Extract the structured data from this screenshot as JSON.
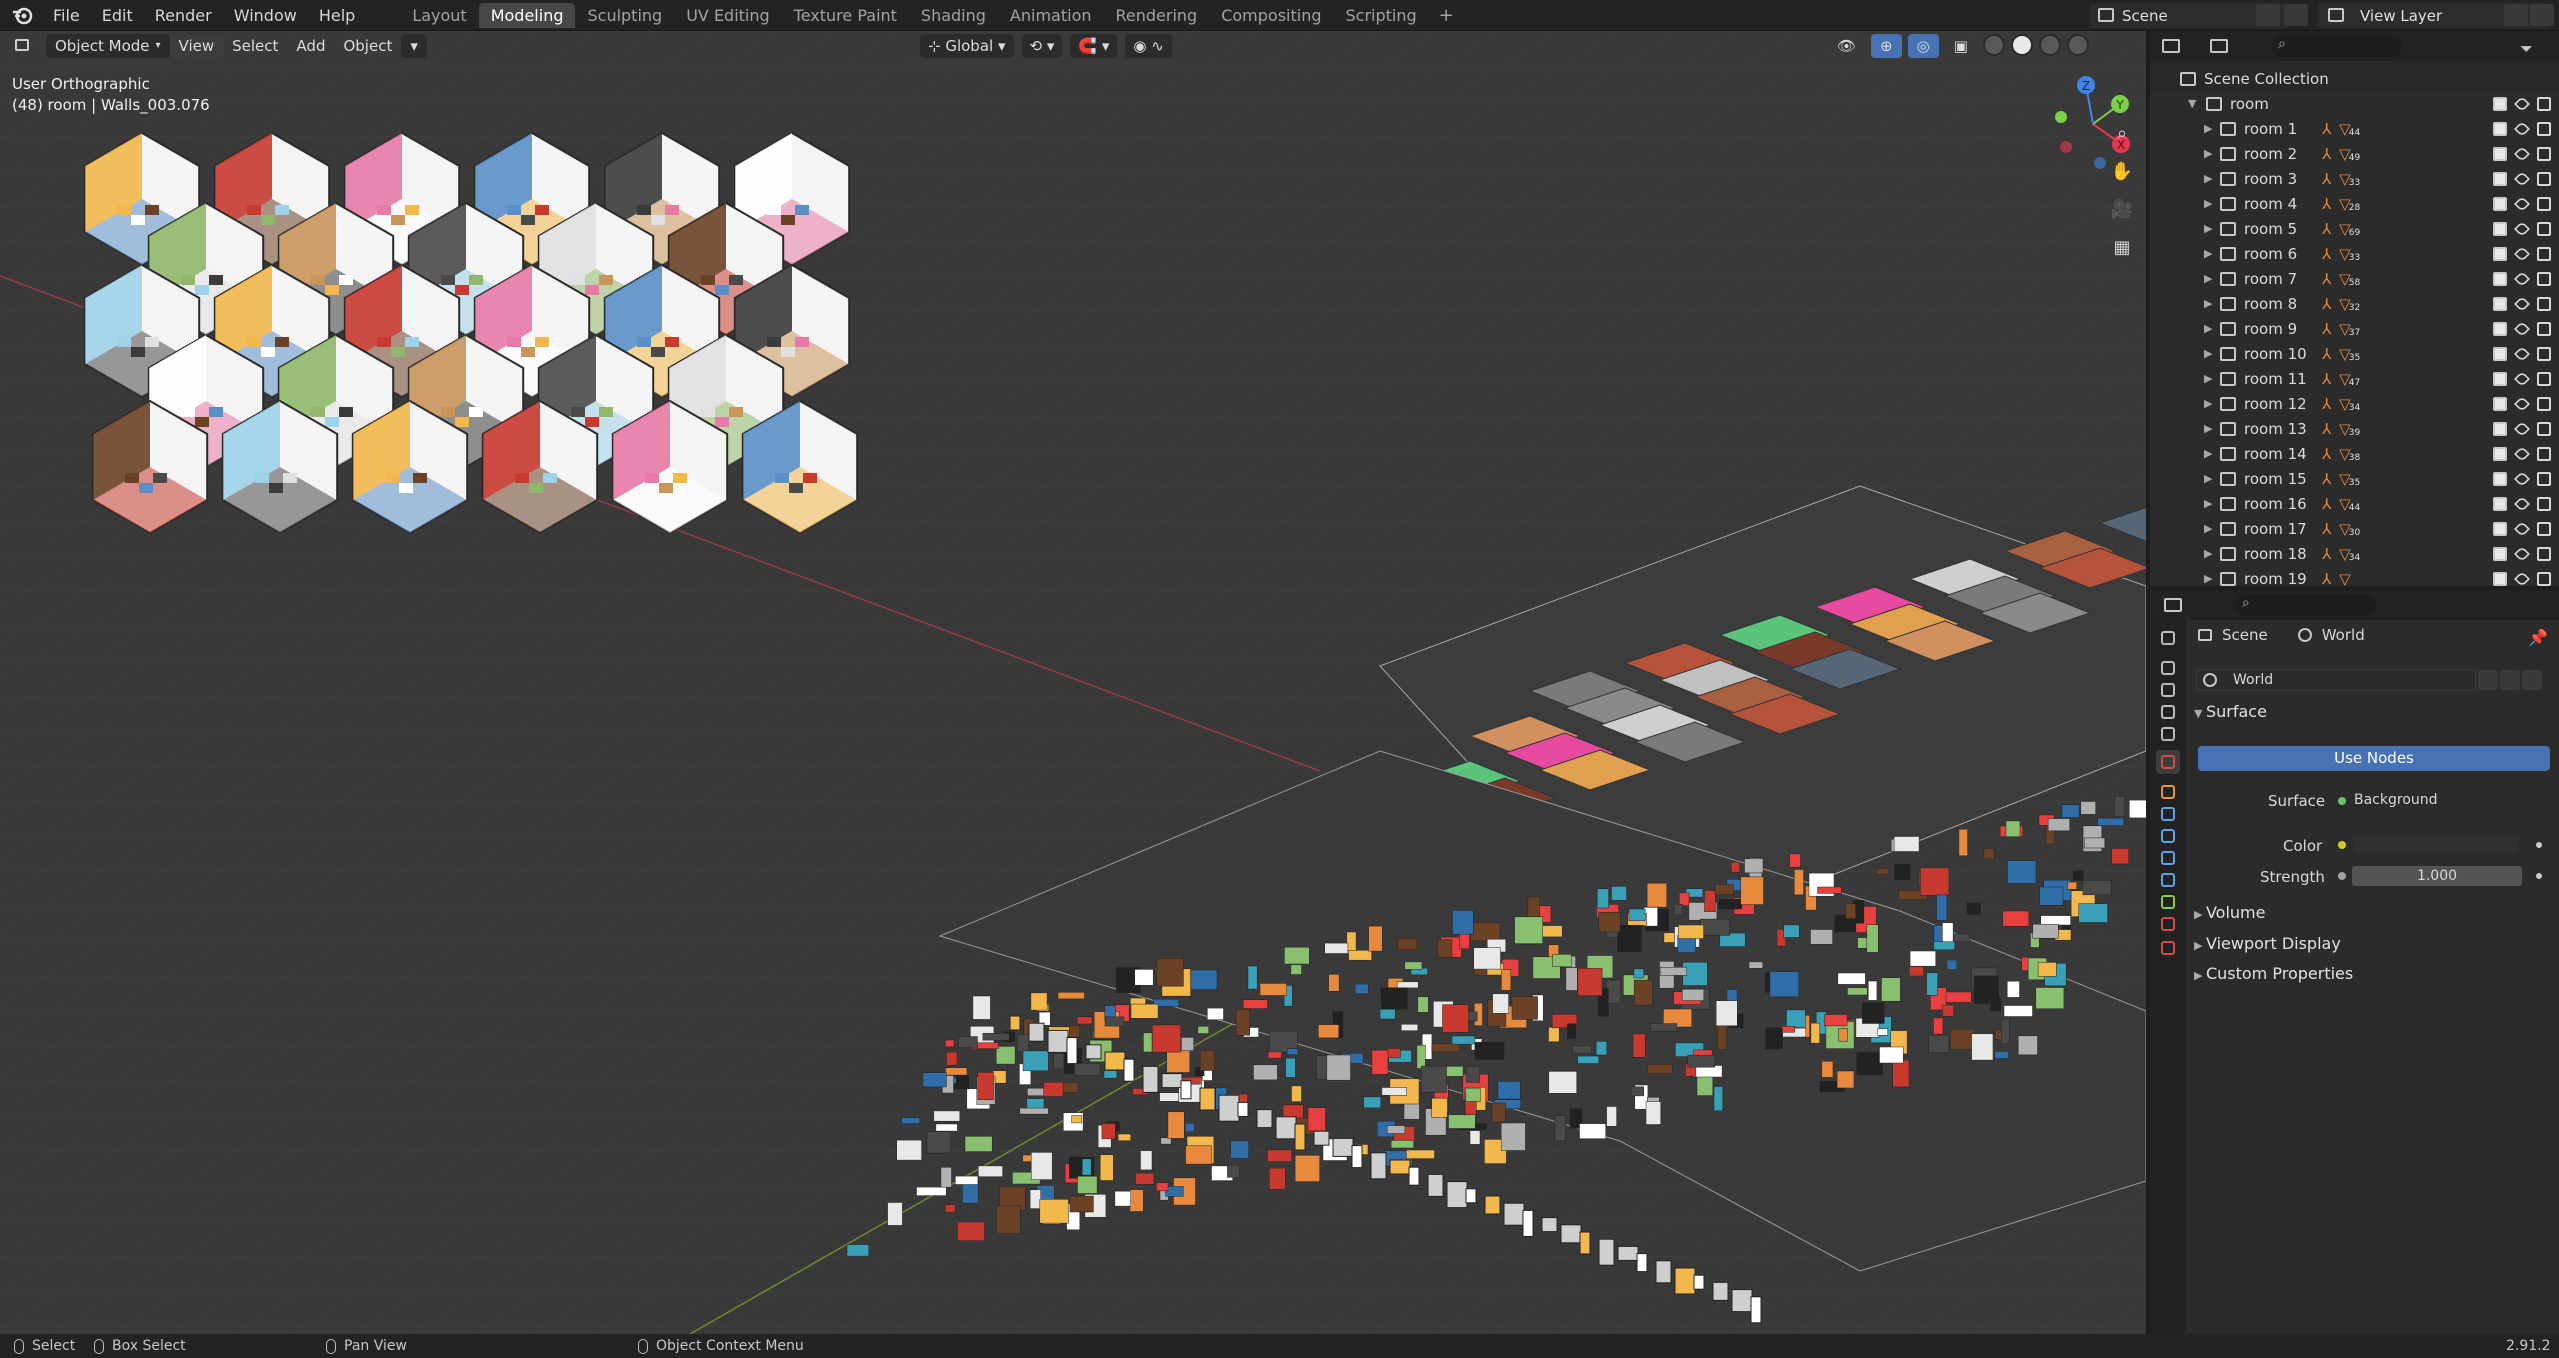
{
  "menubar": {
    "items": [
      "File",
      "Edit",
      "Render",
      "Window",
      "Help"
    ]
  },
  "workspaces": {
    "tabs": [
      "Layout",
      "Modeling",
      "Sculpting",
      "UV Editing",
      "Texture Paint",
      "Shading",
      "Animation",
      "Rendering",
      "Compositing",
      "Scripting"
    ],
    "active": "Modeling",
    "add": "+"
  },
  "scene": {
    "name": "Scene"
  },
  "view_layer": {
    "name": "View Layer"
  },
  "viewport": {
    "mode": "Object Mode",
    "menus": [
      "View",
      "Select",
      "Add",
      "Object"
    ],
    "view_name": "User Orthographic",
    "active_info": "(48) room | Walls_003.076",
    "transform_orientation": "Global",
    "gizmo": {
      "x": "X",
      "y": "Y",
      "z": "Z",
      "x_color": "#e8384f",
      "y_color": "#7fcf4a",
      "z_color": "#3f86e8"
    }
  },
  "outliner": {
    "search_placeholder": "",
    "root": "Scene Collection",
    "collection": "room",
    "rows": [
      {
        "label": "room 1",
        "count": "44"
      },
      {
        "label": "room 2",
        "count": "49"
      },
      {
        "label": "room 3",
        "count": "33"
      },
      {
        "label": "room 4",
        "count": "28"
      },
      {
        "label": "room 5",
        "count": "69"
      },
      {
        "label": "room 6",
        "count": "33"
      },
      {
        "label": "room 7",
        "count": "58"
      },
      {
        "label": "room 8",
        "count": "32"
      },
      {
        "label": "room 9",
        "count": "37"
      },
      {
        "label": "room 10",
        "count": "35"
      },
      {
        "label": "room 11",
        "count": "47"
      },
      {
        "label": "room 12",
        "count": "34"
      },
      {
        "label": "room 13",
        "count": "39"
      },
      {
        "label": "room 14",
        "count": "38"
      },
      {
        "label": "room 15",
        "count": "35"
      },
      {
        "label": "room 16",
        "count": "44"
      },
      {
        "label": "room 17",
        "count": "30"
      },
      {
        "label": "room 18",
        "count": "34"
      },
      {
        "label": "room 19",
        "count": ""
      }
    ]
  },
  "properties": {
    "breadcrumb_scene": "Scene",
    "breadcrumb_world": "World",
    "world_name": "World",
    "surface_panel": "Surface",
    "use_nodes": "Use Nodes",
    "surface_label": "Surface",
    "surface_value": "Background",
    "color_label": "Color",
    "strength_label": "Strength",
    "strength_value": "1.000",
    "volume_panel": "Volume",
    "viewport_display_panel": "Viewport Display",
    "custom_properties_panel": "Custom Properties",
    "accent_color": "#4772b3"
  },
  "statusbar": {
    "select": "Select",
    "box_select": "Box Select",
    "pan_view": "Pan View",
    "context_menu": "Object Context Menu",
    "version": "2.91.2"
  }
}
